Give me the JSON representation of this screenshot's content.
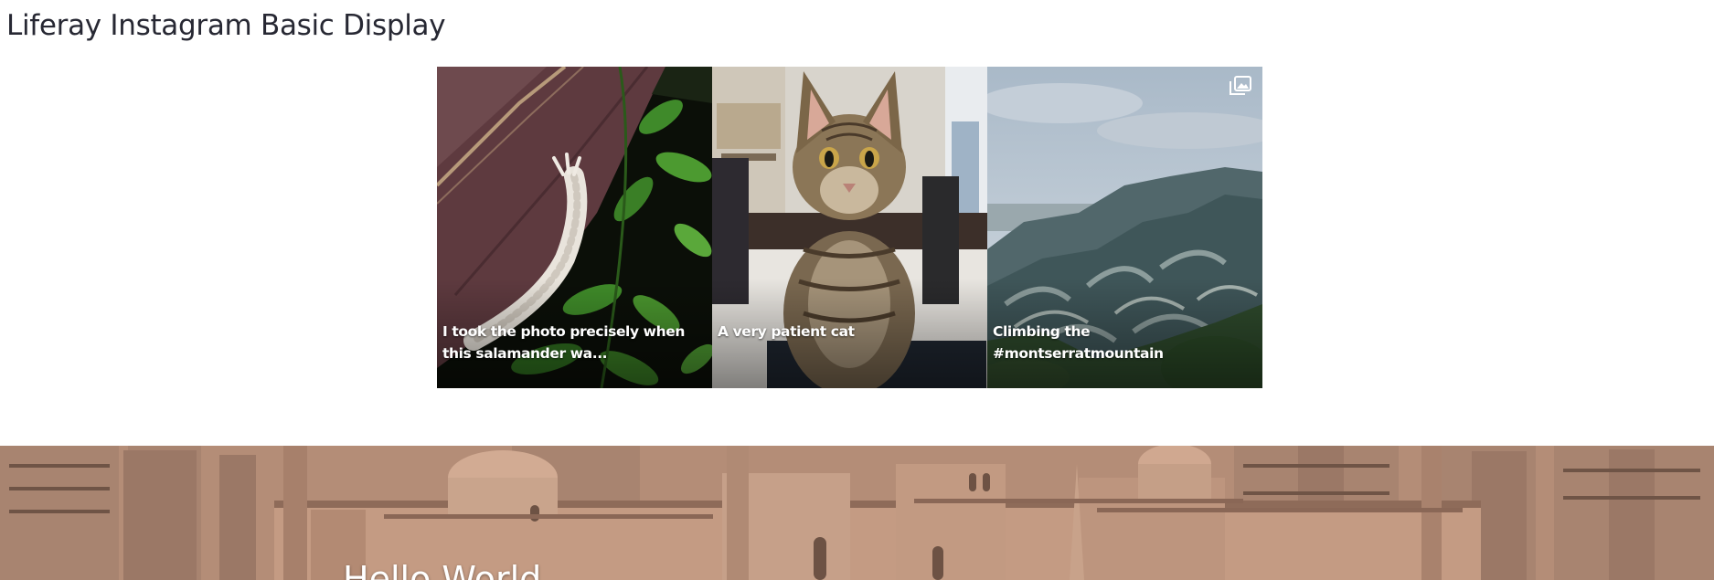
{
  "portlet": {
    "title": "Liferay Instagram Basic Display"
  },
  "posts": [
    {
      "caption": "I took the photo precisely when this salamander wa...",
      "image": "salamander-on-wood-photo"
    },
    {
      "caption": "A very patient cat",
      "image": "tabby-cat-photo"
    },
    {
      "caption": "Climbing the #montserratmountain",
      "image": "montserrat-mountain-photo",
      "album_icon": "album-icon"
    }
  ],
  "banner": {
    "title": "Hello World",
    "image": "cairo-citadel-cityscape-photo"
  },
  "colors": {
    "title_text": "#272833",
    "caption_text": "#ffffff"
  }
}
